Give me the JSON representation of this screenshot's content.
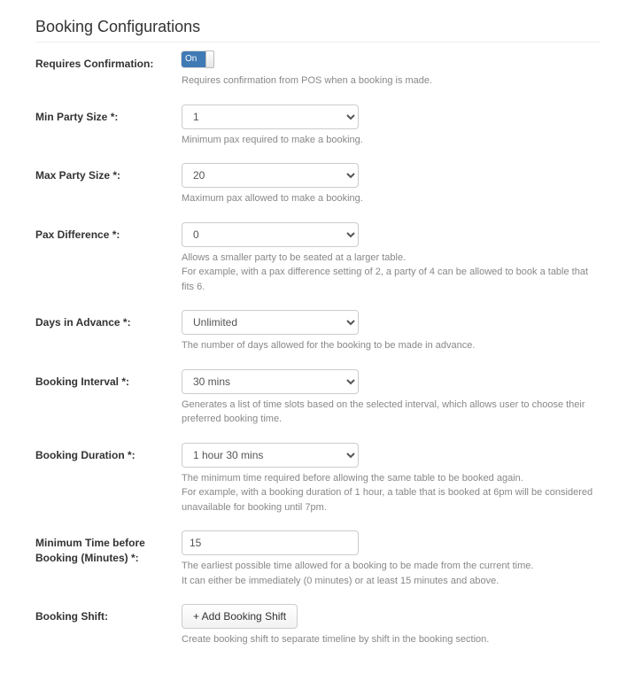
{
  "title": "Booking Configurations",
  "requiresConfirmation": {
    "label": "Requires Confirmation:",
    "toggleValue": "On",
    "help": "Requires confirmation from POS when a booking is made."
  },
  "minPartySize": {
    "label": "Min Party Size *:",
    "value": "1",
    "help": "Minimum pax required to make a booking."
  },
  "maxPartySize": {
    "label": "Max Party Size *:",
    "value": "20",
    "help": "Maximum pax allowed to make a booking."
  },
  "paxDifference": {
    "label": "Pax Difference *:",
    "value": "0",
    "help1": "Allows a smaller party to be seated at a larger table.",
    "help2": "For example, with a pax difference setting of 2, a party of 4 can be allowed to book a table that fits 6."
  },
  "daysInAdvance": {
    "label": "Days in Advance *:",
    "value": "Unlimited",
    "help": "The number of days allowed for the booking to be made in advance."
  },
  "bookingInterval": {
    "label": "Booking Interval *:",
    "value": "30 mins",
    "help": "Generates a list of time slots based on the selected interval, which allows user to choose their preferred booking time."
  },
  "bookingDuration": {
    "label": "Booking Duration *:",
    "value": "1 hour 30 mins",
    "help1": "The minimum time required before allowing the same table to be booked again.",
    "help2": "For example, with a booking duration of 1 hour, a table that is booked at 6pm will be considered unavailable for booking until 7pm."
  },
  "minTimeBefore": {
    "label": "Minimum Time before Booking (Minutes) *:",
    "value": "15",
    "help1": "The earliest possible time allowed for a booking to be made from the current time.",
    "help2": "It can either be immediately (0 minutes) or at least 15 minutes and above."
  },
  "bookingShift": {
    "label": "Booking Shift:",
    "buttonLabel": "+ Add Booking Shift",
    "help": "Create booking shift to separate timeline by shift in the booking section."
  }
}
